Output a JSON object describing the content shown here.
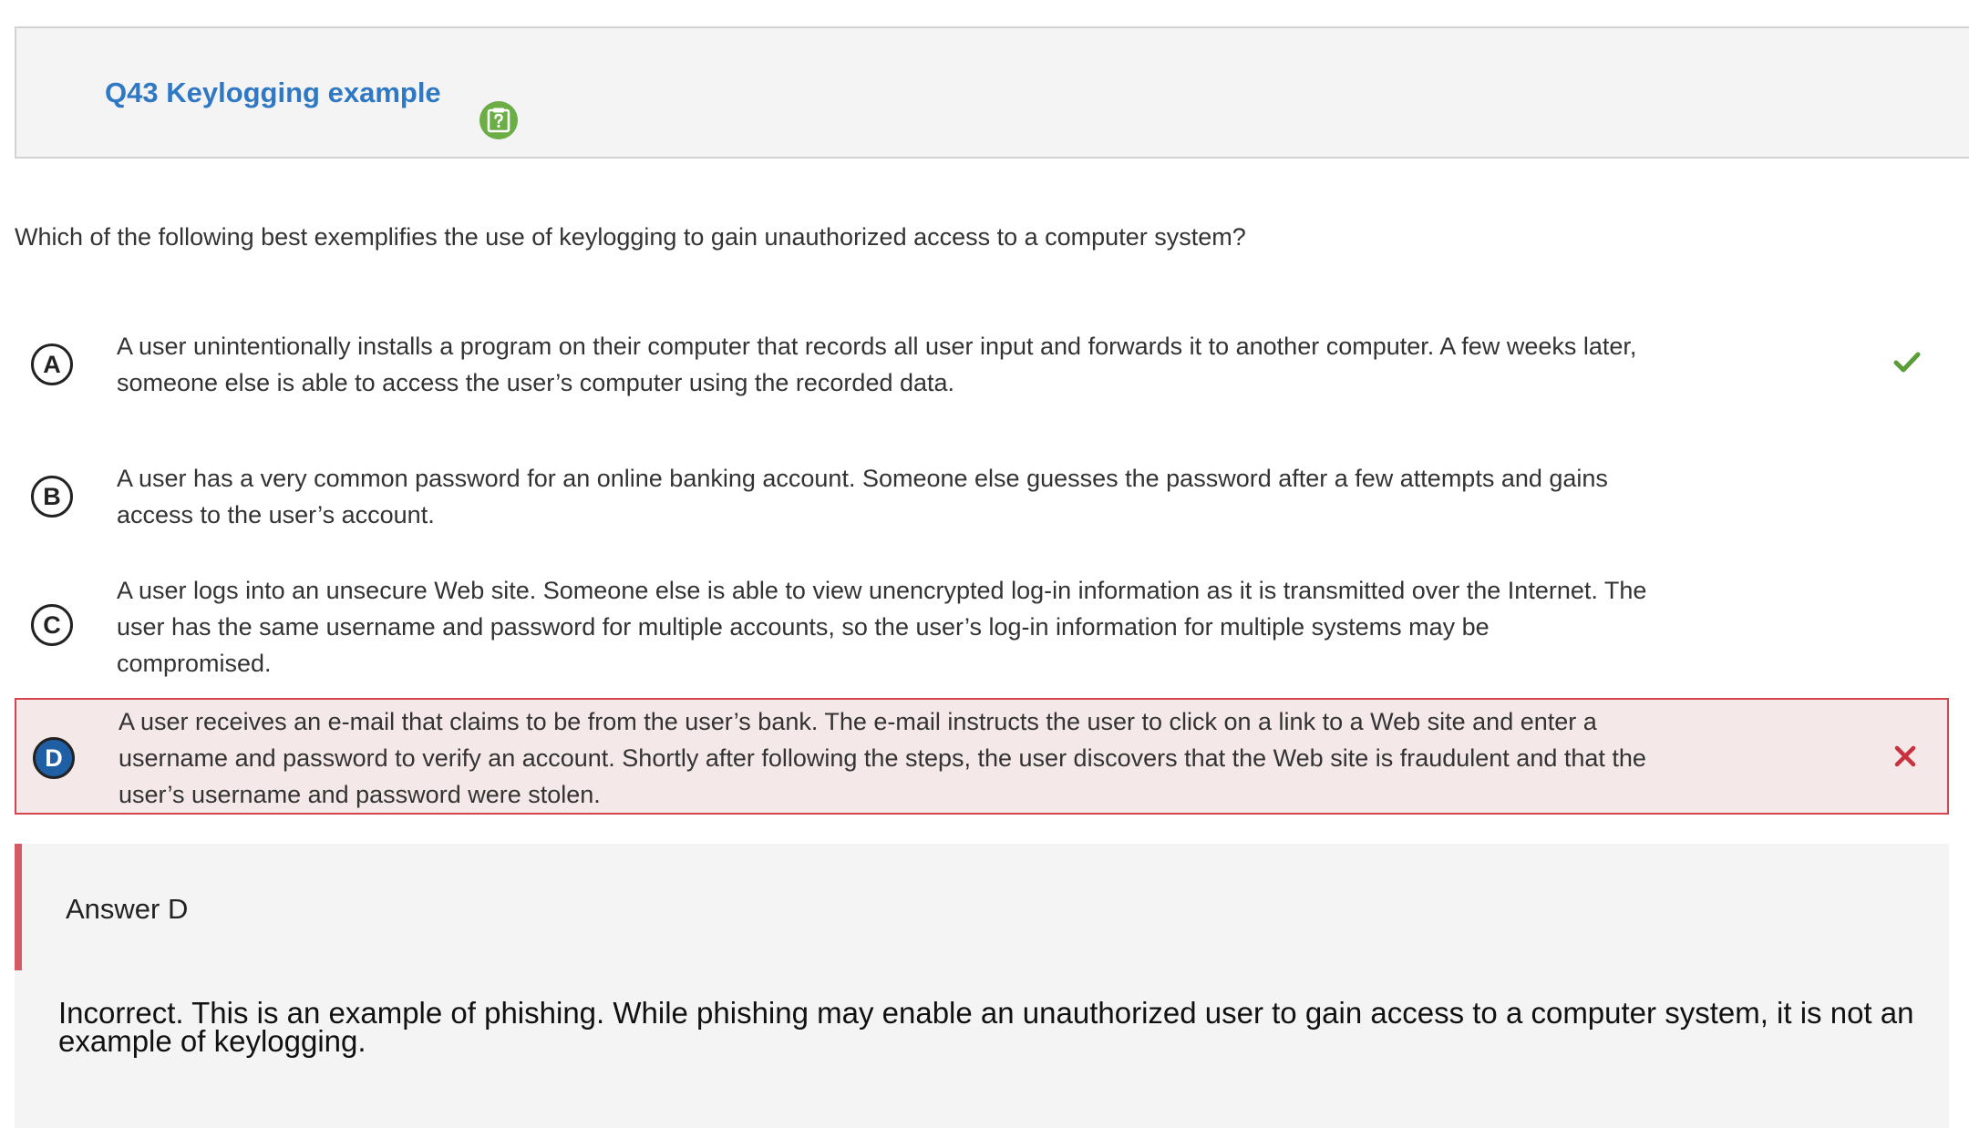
{
  "header": {
    "title": "Q43 Keylogging example",
    "help_icon": "question-mark-icon",
    "help_icon_color": "#6aae45",
    "title_color": "#2f78c4"
  },
  "question": {
    "text": "Which of the following best exemplifies the use of keylogging to gain unauthorized access to a computer system?"
  },
  "options": [
    {
      "letter": "A",
      "text": "A user unintentionally installs a program on their computer that records all user input and forwards it to another computer. A few weeks later, someone else is able to access the user’s computer using the recorded data.",
      "status": "correct",
      "status_icon": "checkmark-icon"
    },
    {
      "letter": "B",
      "text": "A user has a very common password for an online banking account. Someone else guesses the password after a few attempts and gains access to the user’s account.",
      "status": "none"
    },
    {
      "letter": "C",
      "text": "A user logs into an unsecure Web site. Someone else is able to view unencrypted log-in information as it is transmitted over the Internet. The user has the same username and password for multiple accounts, so the user’s log-in information for multiple systems may be compromised.",
      "status": "none"
    },
    {
      "letter": "D",
      "text": "A user receives an e-mail that claims to be from the user’s bank. The e-mail instructs the user to click on a link to a Web site and enter a username and password to verify an account. Shortly after following the steps, the user discovers that the Web site is fraudulent and that the user’s username and password were stolen.",
      "status": "selected-incorrect",
      "status_icon": "x-icon"
    }
  ],
  "answer": {
    "label": "Answer D",
    "explanation": "Incorrect. This is an example of phishing. While phishing may enable an unauthorized user to gain access to a computer system, it is not an example of keylogging."
  },
  "colors": {
    "correct": "#5a9e3a",
    "incorrect": "#c8323e",
    "selected_bg": "#f4e8e8",
    "selected_letter_bg": "#1f5fa6"
  }
}
